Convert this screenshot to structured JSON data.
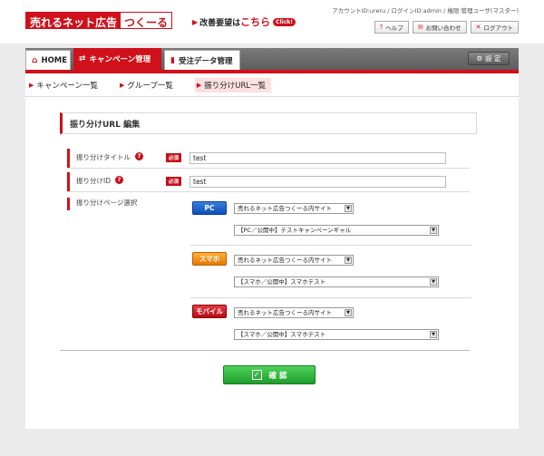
{
  "header": {
    "logo_main": "売れるネット広告",
    "logo_sub": "つくーる",
    "kaizen_prefix": "改善要望は",
    "kaizen_link": "こちら",
    "click_badge": "Click!",
    "account_info": "アカウントID:ureru / ログインID:admin / 権限:管理ユーザ(マスター)",
    "util_buttons": {
      "help": "ヘルプ",
      "contact": "お問い合わせ",
      "logout": "ログアウト"
    }
  },
  "nav": {
    "tabs": {
      "home": "HOME",
      "campaign": "キャンペーン管理",
      "order": "受注データ管理"
    },
    "settings": "設 定"
  },
  "subnav": {
    "items": [
      "キャンペーン一覧",
      "グループ一覧",
      "振り分けURL一覧"
    ]
  },
  "form": {
    "section_title": "振り分けURL 編集",
    "required_badge": "必須",
    "title_label": "振り分けタイトル",
    "title_value": "test",
    "id_label": "振り分けID",
    "id_value": "test",
    "page_label": "振り分けページ選択",
    "devices": {
      "pc": {
        "label": "PC",
        "site": "売れるネット広告つくーる内サイト",
        "page": "【PC／公開中】テストキャンペーンギャル"
      },
      "sp": {
        "label": "スマホ",
        "site": "売れるネット広告つくーる内サイト",
        "page": "【スマホ／公開中】スマホテスト"
      },
      "mobile": {
        "label": "モバイル",
        "site": "売れるネット広告つくーる内サイト",
        "page": "【スマホ／公開中】スマホテスト"
      }
    },
    "confirm_label": "確 認"
  },
  "colors": {
    "brand_red": "#d0101a",
    "pc_blue": "#0c4fb8",
    "sp_orange": "#e67a00",
    "confirm_green": "#1f9d2c"
  }
}
